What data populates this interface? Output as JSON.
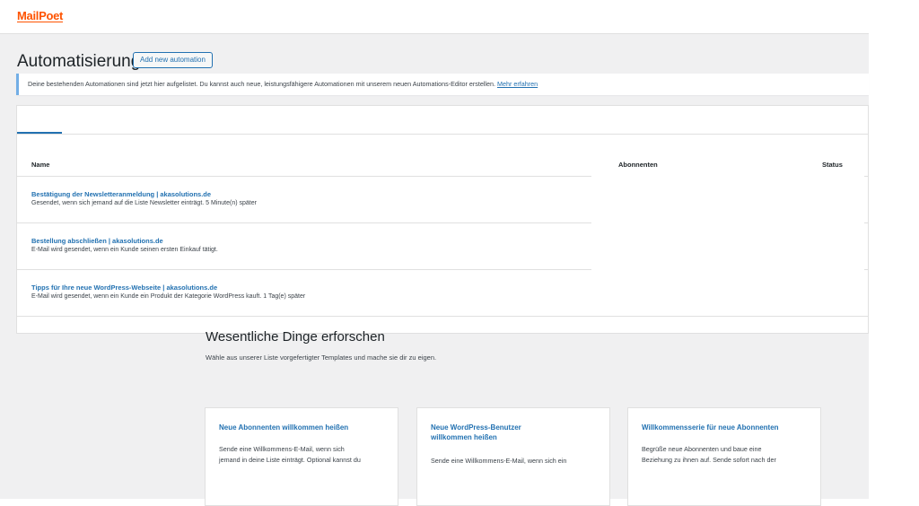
{
  "header": {
    "logo_text": "MailPoet"
  },
  "page": {
    "title": "Automatisierungen",
    "add_button": "Add new automation"
  },
  "notice": {
    "text": "Deine bestehenden Automationen sind jetzt hier aufgelistet. Du kannst auch neue, leistungsfähigere Automationen mit unserem neuen Automations-Editor erstellen. ",
    "link": "Mehr erfahren"
  },
  "table": {
    "columns": {
      "name": "Name",
      "subscribers": "Abonnenten",
      "status": "Status"
    },
    "rows": [
      {
        "title": "Bestätigung der Newsletteranmeldung | akasolutions.de",
        "description": "Gesendet, wenn sich jemand auf die Liste Newsletter einträgt. 5 Minute(n) später"
      },
      {
        "title": "Bestellung abschließen | akasolutions.de",
        "description": "E-Mail wird gesendet, wenn ein Kunde seinen ersten Einkauf tätigt."
      },
      {
        "title": "Tipps für Ihre neue WordPress-Webseite | akasolutions.de",
        "description": "E-Mail wird gesendet, wenn ein Kunde ein Produkt der Kategorie WordPress kauft. 1 Tag(e) später"
      }
    ]
  },
  "explore": {
    "title": "Wesentliche Dinge erforschen",
    "subtitle": "Wähle aus unserer Liste vorgefertigter Templates und mache sie dir zu eigen.",
    "cards": [
      {
        "title": "Neue Abonnenten willkommen heißen",
        "desc_line1": "Sende eine Willkommens-E-Mail, wenn sich",
        "desc_line2": "jemand in deine Liste einträgt. Optional kannst du"
      },
      {
        "title_line1": "Neue WordPress-Benutzer",
        "title_line2": "willkommen heißen",
        "desc_line1": "Sende eine Willkommens-E-Mail, wenn sich ein"
      },
      {
        "title": "Willkommensserie für neue Abonnenten",
        "desc_line1": "Begrüße neue Abonnenten und baue eine",
        "desc_line2": "Beziehung zu ihnen auf. Sende sofort nach der"
      }
    ]
  },
  "colors": {
    "brand": "#fe5301",
    "link": "#2271b1",
    "notice_border": "#72aee6",
    "background": "#f0f0f1"
  }
}
